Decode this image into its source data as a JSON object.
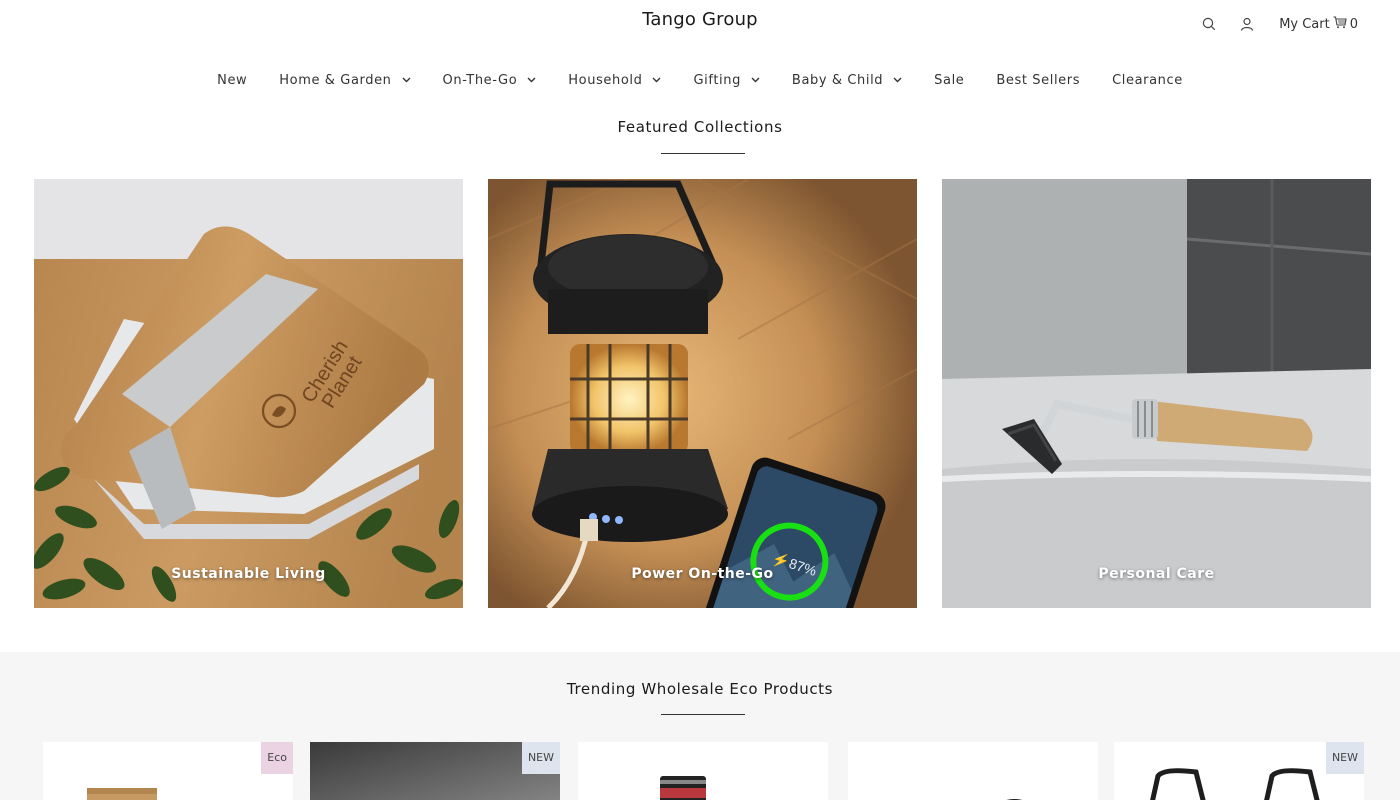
{
  "header": {
    "brand": "Tango Group",
    "icons": [
      "search-icon",
      "user-icon",
      "cart-icon"
    ],
    "cart_label": "My Cart",
    "cart_count": "0"
  },
  "nav": {
    "items": [
      {
        "label": "New",
        "has_dropdown": false
      },
      {
        "label": "Home & Garden",
        "has_dropdown": true
      },
      {
        "label": "On-The-Go",
        "has_dropdown": true
      },
      {
        "label": "Household",
        "has_dropdown": true
      },
      {
        "label": "Gifting",
        "has_dropdown": true
      },
      {
        "label": "Baby & Child",
        "has_dropdown": true
      },
      {
        "label": "Sale",
        "has_dropdown": false
      },
      {
        "label": "Best Sellers",
        "has_dropdown": false
      },
      {
        "label": "Clearance",
        "has_dropdown": false
      }
    ]
  },
  "featured": {
    "title": "Featured Collections",
    "collections": [
      {
        "label": "Sustainable Living"
      },
      {
        "label": "Power On-the-Go"
      },
      {
        "label": "Personal Care"
      }
    ]
  },
  "image_text": {
    "lunchbox_logo_line1": "Cherish",
    "lunchbox_logo_line2": "Planet",
    "phone_charge": "⚡87%"
  },
  "trending": {
    "title": "Trending Wholesale Eco Products",
    "products": [
      {
        "badge": "Eco"
      },
      {
        "badge": "NEW"
      },
      {
        "badge": ""
      },
      {
        "badge": ""
      },
      {
        "badge": "NEW"
      }
    ]
  },
  "colors": {
    "eco_badge": "#ecd3e4",
    "new_badge": "#dde4ee",
    "trending_background": "#f6f6f6"
  }
}
